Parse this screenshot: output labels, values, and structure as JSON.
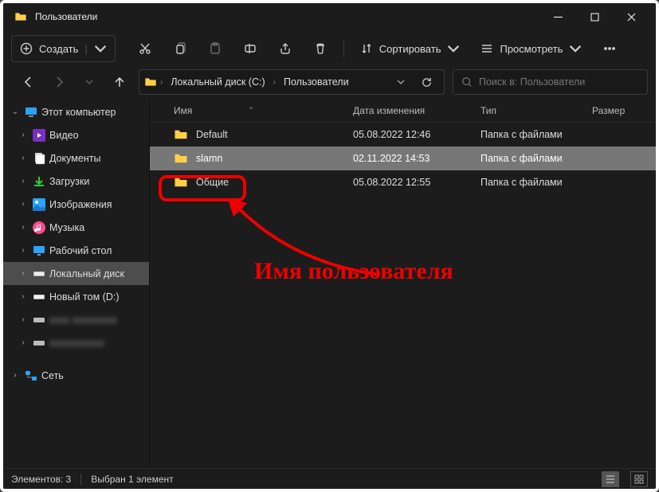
{
  "titlebar": {
    "title": "Пользователи"
  },
  "toolbar": {
    "create_label": "Создать",
    "sort_label": "Сортировать",
    "view_label": "Просмотреть"
  },
  "breadcrumbs": {
    "item1": "Локальный диск (C:)",
    "item2": "Пользователи"
  },
  "search": {
    "placeholder": "Поиск в: Пользователи"
  },
  "sidebar": {
    "this_pc": "Этот компьютер",
    "videos": "Видео",
    "documents": "Документы",
    "downloads": "Загрузки",
    "pictures": "Изображения",
    "music": "Музыка",
    "desktop": "Рабочий стол",
    "localdisk": "Локальный диск",
    "newvol": "Новый том (D:)",
    "hidden1": "xxxx xxxxxxxxx",
    "hidden2": "xxxxxxxxxxx",
    "network": "Сеть"
  },
  "columns": {
    "name": "Имя",
    "modified": "Дата изменения",
    "type": "Тип",
    "size": "Размер"
  },
  "rows": [
    {
      "name": "Default",
      "date": "05.08.2022 12:46",
      "type": "Папка с файлами",
      "size": ""
    },
    {
      "name": "slamn",
      "date": "02.11.2022 14:53",
      "type": "Папка с файлами",
      "size": ""
    },
    {
      "name": "Общие",
      "date": "05.08.2022 12:55",
      "type": "Папка с файлами",
      "size": ""
    }
  ],
  "status": {
    "count": "Элементов: 3",
    "selected": "Выбран 1 элемент"
  },
  "annotation": {
    "label": "Имя пользователя"
  }
}
